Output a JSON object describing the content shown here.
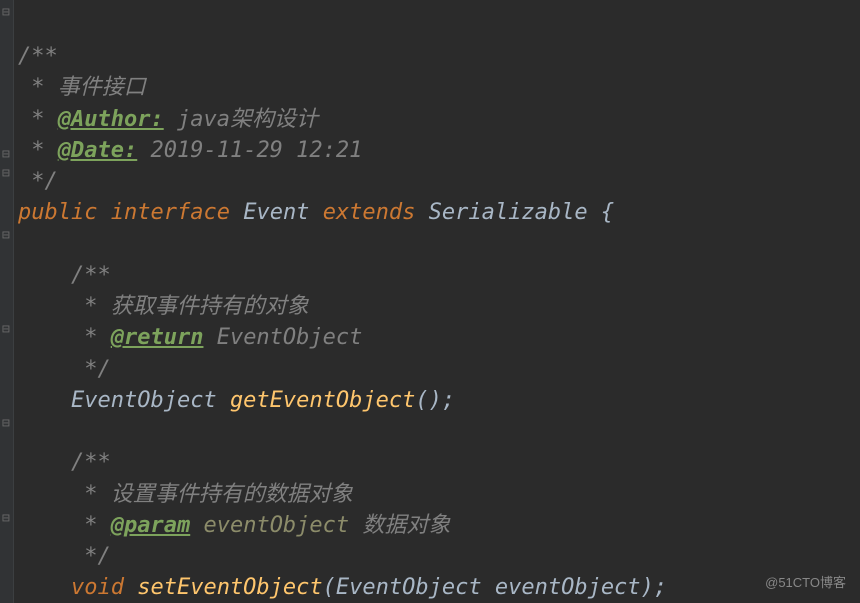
{
  "code": {
    "doc_open": "/**",
    "doc_star": " * ",
    "doc_desc1": "事件接口",
    "tag_author_label": "@Author:",
    "tag_author_value": " java架构设计",
    "tag_date_label": "@Date:",
    "tag_date_value": " 2019-11-29 12:21",
    "doc_close": " */",
    "kw_public": "public",
    "kw_interface": "interface",
    "cls_event": "Event",
    "kw_extends": "extends",
    "cls_serializable": "Serializable",
    "brace_open": " {",
    "m1_doc_open": "/**",
    "m1_doc_desc": "获取事件持有的对象",
    "m1_tag_return": "@return",
    "m1_tag_return_value": " EventObject",
    "m1_doc_close": " */",
    "m1_return_type": "EventObject",
    "m1_name": "getEventObject",
    "m1_params": "()",
    "semicolon": ";",
    "m2_doc_open": "/**",
    "m2_doc_desc": "设置事件持有的数据对象",
    "m2_tag_param": "@param",
    "m2_param_name": " eventObject",
    "m2_param_desc": " 数据对象",
    "m2_doc_close": " */",
    "m2_return_type": "void",
    "m2_name": "setEventObject",
    "m2_params_open": "(",
    "m2_param_type": "EventObject",
    "m2_param_var": " eventObject",
    "m2_params_close": ")"
  },
  "watermark": "@51CTO博客"
}
